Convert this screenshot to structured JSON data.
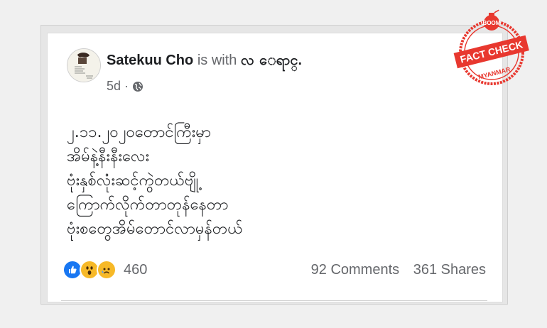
{
  "post": {
    "author": "Satekuu Cho",
    "with_text": "is with",
    "tagged": "လ ေရာင္.",
    "time": "5d",
    "separator": "·",
    "privacy_icon": "globe-icon",
    "body_lines": [
      "၂.၁၁.၂၀၂၀တောင်ကြီးမှာ",
      "အိမ်နဲ့နီးနီးလေး",
      "ဗုံးနှစ်လုံးဆင့်ကွဲတယ်ဗျို့",
      "ကြောက်လိုက်တာတုန်နေတာ",
      "ဗုံးစတွေအိမ်တောင်လာမှန်တယ်"
    ]
  },
  "reactions": {
    "icons": [
      "like-icon",
      "wow-icon",
      "sad-icon"
    ],
    "count": "460"
  },
  "engagement": {
    "comments": "92 Comments",
    "shares": "361 Shares"
  },
  "stamp": {
    "top": "BOOM",
    "main": "FACT CHECK",
    "bottom": "MYANMAR",
    "color": "#e8382f"
  }
}
